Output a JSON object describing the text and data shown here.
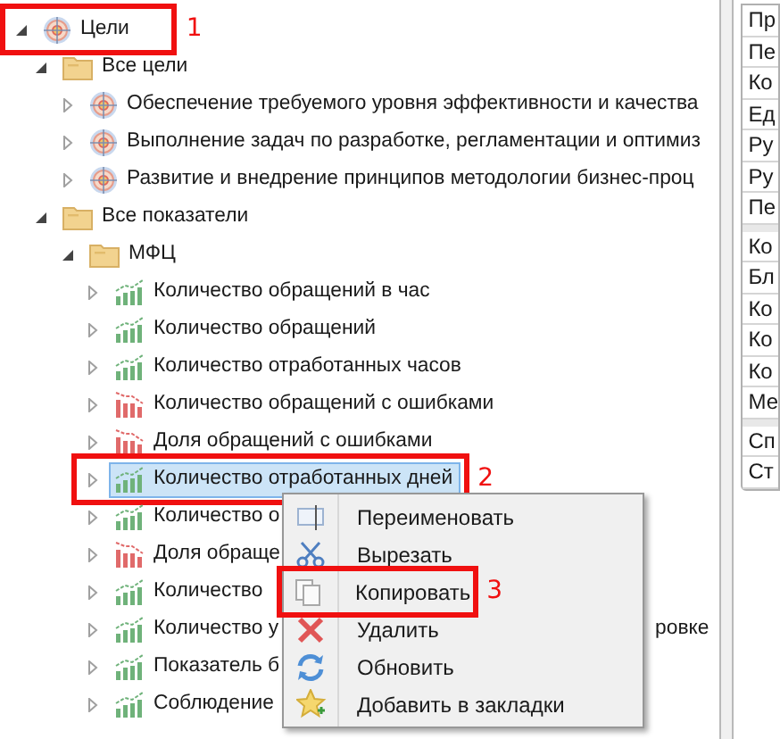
{
  "tree": [
    {
      "label": "Цели",
      "kind": "goal",
      "expanded": true,
      "selected": false,
      "annotation": "1",
      "children": [
        {
          "label": "Все цели",
          "kind": "folder",
          "expanded": true,
          "selected": false,
          "children": [
            {
              "label": "Обеспечение требуемого уровня эффективности и качества",
              "kind": "goal",
              "expanded": false,
              "selected": false
            },
            {
              "label": "Выполнение задач по разработке, регламентации и оптимиз",
              "kind": "goal",
              "expanded": false,
              "selected": false
            },
            {
              "label": "Развитие и внедрение принципов методологии бизнес-проц",
              "kind": "goal",
              "expanded": false,
              "selected": false
            }
          ]
        },
        {
          "label": "Все показатели",
          "kind": "folder",
          "expanded": true,
          "selected": false,
          "children": [
            {
              "label": "МФЦ",
              "kind": "folder",
              "expanded": true,
              "selected": false,
              "children": [
                {
                  "label": "Количество обращений в час",
                  "kind": "chart-up",
                  "expanded": false,
                  "selected": false
                },
                {
                  "label": "Количество обращений",
                  "kind": "chart-up",
                  "expanded": false,
                  "selected": false
                },
                {
                  "label": "Количество отработанных часов",
                  "kind": "chart-up",
                  "expanded": false,
                  "selected": false
                },
                {
                  "label": "Количество обращений с ошибками",
                  "kind": "chart-down",
                  "expanded": false,
                  "selected": false
                },
                {
                  "label": "Доля обращений с ошибками",
                  "kind": "chart-down",
                  "expanded": false,
                  "selected": false
                },
                {
                  "label": "Количество отработанных дней",
                  "kind": "chart-up",
                  "expanded": false,
                  "selected": true,
                  "annotation": "2"
                },
                {
                  "label": "Количество о",
                  "kind": "chart-up",
                  "expanded": false,
                  "selected": false
                },
                {
                  "label": "Доля обраще",
                  "kind": "chart-down",
                  "expanded": false,
                  "selected": false
                },
                {
                  "label": "Количество",
                  "kind": "chart-up",
                  "expanded": false,
                  "selected": false
                },
                {
                  "label": "Количество у",
                  "tail": "ровке",
                  "kind": "chart-up",
                  "expanded": false,
                  "selected": false
                },
                {
                  "label": "Показатель б",
                  "kind": "chart-up",
                  "expanded": false,
                  "selected": false
                },
                {
                  "label": "Соблюдение",
                  "kind": "chart-up",
                  "expanded": false,
                  "selected": false
                }
              ]
            }
          ]
        }
      ]
    }
  ],
  "context_menu": [
    {
      "label": "Переименовать",
      "kind": "rename"
    },
    {
      "label": "Вырезать",
      "kind": "cut"
    },
    {
      "label": "Копировать",
      "kind": "copy",
      "annotation": "3"
    },
    {
      "label": "Удалить",
      "kind": "delete"
    },
    {
      "label": "Обновить",
      "kind": "refresh"
    },
    {
      "label": "Добавить в закладки",
      "kind": "bookmark"
    }
  ],
  "properties": [
    [
      "Пр",
      "Пе",
      "Ко",
      "Ед",
      "Ру",
      "Ру",
      "Пе"
    ],
    [
      "Ко",
      "Бл",
      "Ко",
      "Ко",
      "Ко",
      "Ме"
    ],
    [
      "Сп",
      "Ст"
    ]
  ]
}
